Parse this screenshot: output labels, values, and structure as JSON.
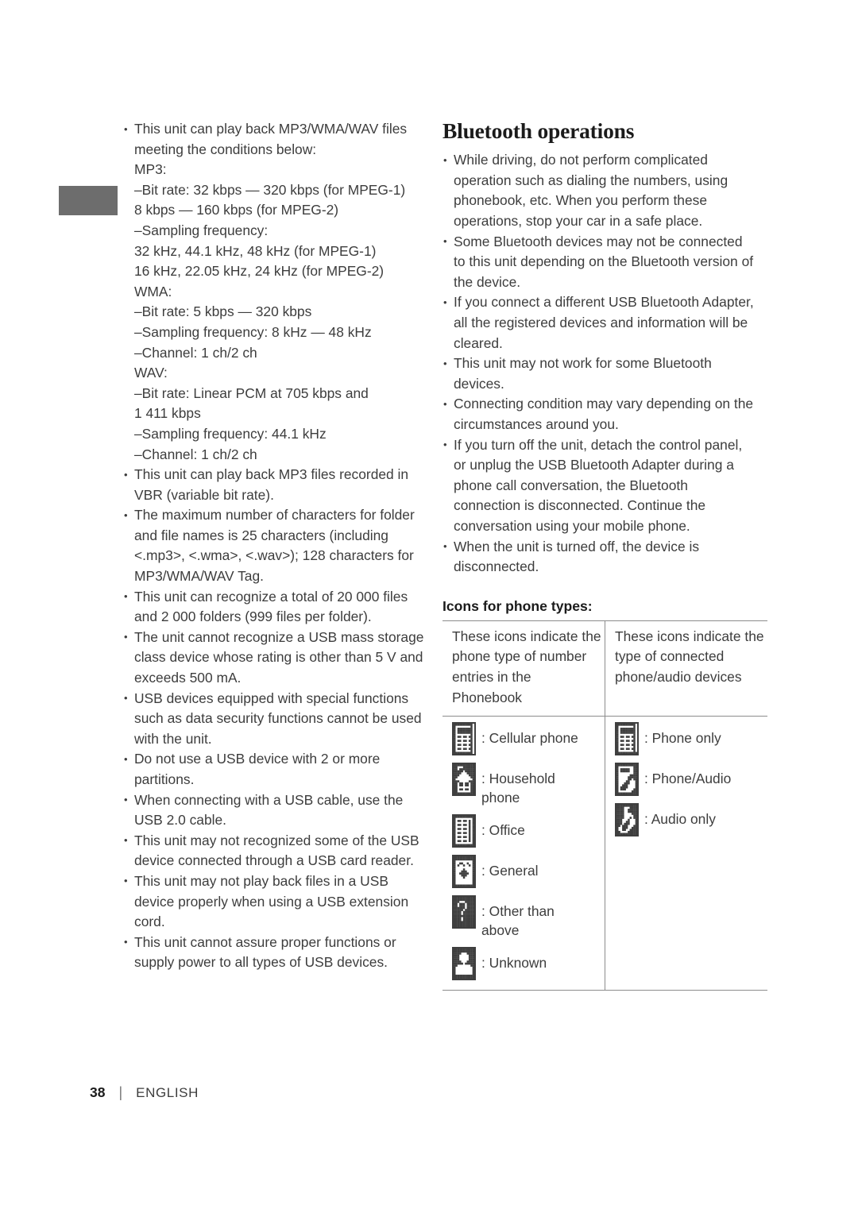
{
  "page": {
    "number": "38",
    "divider": "|",
    "language": "ENGLISH"
  },
  "left_column": {
    "items": [
      {
        "type": "bullet",
        "text": "This unit can play back MP3/WMA/WAV files meeting the conditions below:"
      },
      {
        "type": "plain",
        "indent": 1,
        "text": "MP3:"
      },
      {
        "type": "plain",
        "indent": 1,
        "text": "–Bit rate:  32 kbps — 320 kbps (for MPEG-1)"
      },
      {
        "type": "plain",
        "indent": 3,
        "text": "8 kbps — 160 kbps (for MPEG-2)"
      },
      {
        "type": "plain",
        "indent": 1,
        "text": "–Sampling frequency:"
      },
      {
        "type": "plain",
        "indent": 2,
        "text": "32 kHz, 44.1 kHz, 48 kHz (for MPEG-1)"
      },
      {
        "type": "plain",
        "indent": 2,
        "text": "16 kHz, 22.05 kHz, 24 kHz (for MPEG-2)"
      },
      {
        "type": "plain",
        "indent": 1,
        "text": "WMA:"
      },
      {
        "type": "plain",
        "indent": 1,
        "text": "–Bit rate: 5 kbps — 320 kbps"
      },
      {
        "type": "plain",
        "indent": 1,
        "text": "–Sampling frequency: 8 kHz — 48 kHz"
      },
      {
        "type": "plain",
        "indent": 1,
        "text": "–Channel: 1 ch/2 ch"
      },
      {
        "type": "plain",
        "indent": 1,
        "text": "WAV:"
      },
      {
        "type": "plain",
        "indent": 1,
        "text": "–Bit rate: Linear PCM at 705 kbps and"
      },
      {
        "type": "plain",
        "indent": 4,
        "text": "1 411 kbps"
      },
      {
        "type": "plain",
        "indent": 1,
        "text": "–Sampling frequency: 44.1 kHz"
      },
      {
        "type": "plain",
        "indent": 1,
        "text": "–Channel: 1 ch/2 ch"
      },
      {
        "type": "bullet",
        "text": "This unit can play back MP3 files recorded in VBR (variable bit rate)."
      },
      {
        "type": "bullet",
        "text": "The maximum number of characters for folder and file names is 25 characters (including <.mp3>, <.wma>, <.wav>); 128 characters for MP3/WMA/WAV Tag."
      },
      {
        "type": "bullet",
        "text": "This unit can recognize a total of 20 000 files and 2 000 folders (999 files per folder)."
      },
      {
        "type": "bullet",
        "text": "The unit cannot recognize a USB mass storage class device whose rating is other than 5 V and exceeds 500 mA."
      },
      {
        "type": "bullet",
        "text": "USB devices equipped with special functions such as data security functions cannot be used with the unit."
      },
      {
        "type": "bullet",
        "text": "Do not use a USB device with 2 or more partitions."
      },
      {
        "type": "bullet",
        "text": "When connecting with a USB cable, use the USB 2.0 cable."
      },
      {
        "type": "bullet",
        "text": "This unit may not recognized some of the USB device connected through a USB card reader."
      },
      {
        "type": "bullet",
        "text": "This unit may not play back files in a USB device properly when using a USB extension cord."
      },
      {
        "type": "bullet",
        "text": "This unit cannot assure proper functions or supply power to all types of USB devices."
      }
    ]
  },
  "right_column": {
    "title": "Bluetooth operations",
    "bullets": [
      "While driving, do not perform complicated operation such as dialing the numbers, using phonebook, etc. When you perform these operations, stop your car in a safe place.",
      "Some Bluetooth devices may not be connected to this unit depending on the Bluetooth version of the device.",
      "If you connect a different USB Bluetooth Adapter, all the registered devices and information will be cleared.",
      "This unit may not work for some Bluetooth devices.",
      "Connecting condition may vary depending on the circumstances around you.",
      "If you turn off the unit, detach the control panel, or unplug the USB Bluetooth Adapter during a phone call conversation, the Bluetooth connection is disconnected. Continue the conversation using your mobile phone.",
      "When the unit is turned off, the device is disconnected."
    ],
    "icon_section": {
      "heading": "Icons for phone types:",
      "header_left": "These icons indicate the phone type of number entries in the Phonebook",
      "header_right": "These icons indicate the type of connected phone/audio devices",
      "left_icons": [
        {
          "icon": "cellular-phone-icon",
          "label": ": Cellular phone"
        },
        {
          "icon": "household-phone-icon",
          "label": ": Household\n   phone"
        },
        {
          "icon": "office-building-icon",
          "label": ": Office"
        },
        {
          "icon": "general-icon",
          "label": ": General"
        },
        {
          "icon": "question-mark-icon",
          "label": ": Other than\n   above"
        },
        {
          "icon": "unknown-person-icon",
          "label": ": Unknown"
        }
      ],
      "right_icons": [
        {
          "icon": "phone-only-icon",
          "label": ": Phone only"
        },
        {
          "icon": "phone-audio-icon",
          "label": ": Phone/Audio"
        },
        {
          "icon": "audio-only-icon",
          "label": ": Audio only"
        }
      ]
    }
  },
  "colors": {
    "text": "#3d3d3d",
    "heading": "#1b1b1b",
    "tab": "#6d6d6d",
    "rule": "#8c8c8c",
    "icon": "#3f3f3f"
  }
}
